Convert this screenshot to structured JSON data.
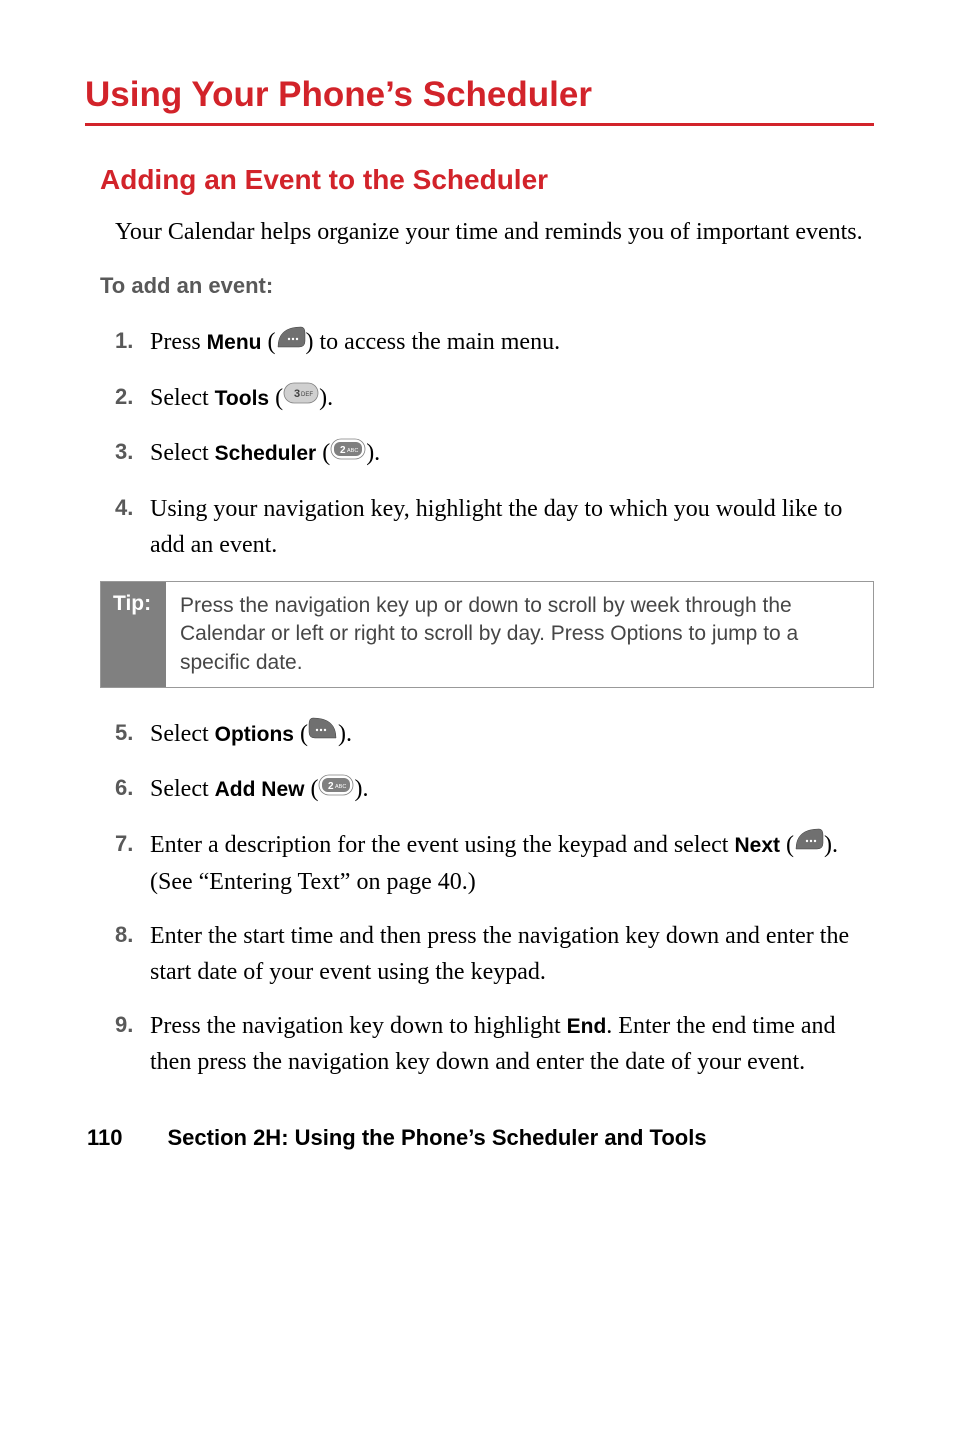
{
  "title": "Using Your Phone’s Scheduler",
  "section_title": "Adding an Event to the Scheduler",
  "intro": "Your Calendar helps organize your time and reminds you of important events.",
  "subhead": "To add an event:",
  "steps": [
    {
      "n": "1.",
      "pre": "Press ",
      "strong": "Menu",
      "mid": " (",
      "icon": "softkey-left",
      "post": ") to access the main menu."
    },
    {
      "n": "2.",
      "pre": "Select ",
      "strong": "Tools",
      "mid": " (",
      "icon": "key-3def",
      "post": ")."
    },
    {
      "n": "3.",
      "pre": "Select ",
      "strong": "Scheduler",
      "mid": " (",
      "icon": "key-2abc",
      "post": ")."
    },
    {
      "n": "4.",
      "text": "Using your navigation key, highlight the day to which you would like to add an event."
    }
  ],
  "tip": {
    "label": "Tip:",
    "text": "Press the navigation key up or down to scroll by week through the Calendar or left or right to scroll by day. Press Options to jump to a specific date."
  },
  "steps2": [
    {
      "n": "5.",
      "pre": "Select ",
      "strong": "Options",
      "mid": " (",
      "icon": "softkey-right",
      "post": ")."
    },
    {
      "n": "6.",
      "pre": "Select ",
      "strong": "Add New",
      "mid": " (",
      "icon": "key-2abc",
      "post": ")."
    },
    {
      "n": "7.",
      "pre": "Enter a description for the event using the keypad and select ",
      "strong": "Next",
      "mid": " (",
      "icon": "softkey-left",
      "post": "). (See “Entering Text” on page 40.)"
    },
    {
      "n": "8.",
      "text": "Enter the start time and then press the navigation key down and enter the start date of your event using the keypad."
    },
    {
      "n": "9.",
      "pre": "Press the navigation key down to highlight ",
      "strong": "End",
      "post2": ". Enter the end time and then press the navigation key down and enter the date of your event."
    }
  ],
  "footer": {
    "page": "110",
    "label": "Section 2H: Using the Phone’s Scheduler and Tools"
  }
}
